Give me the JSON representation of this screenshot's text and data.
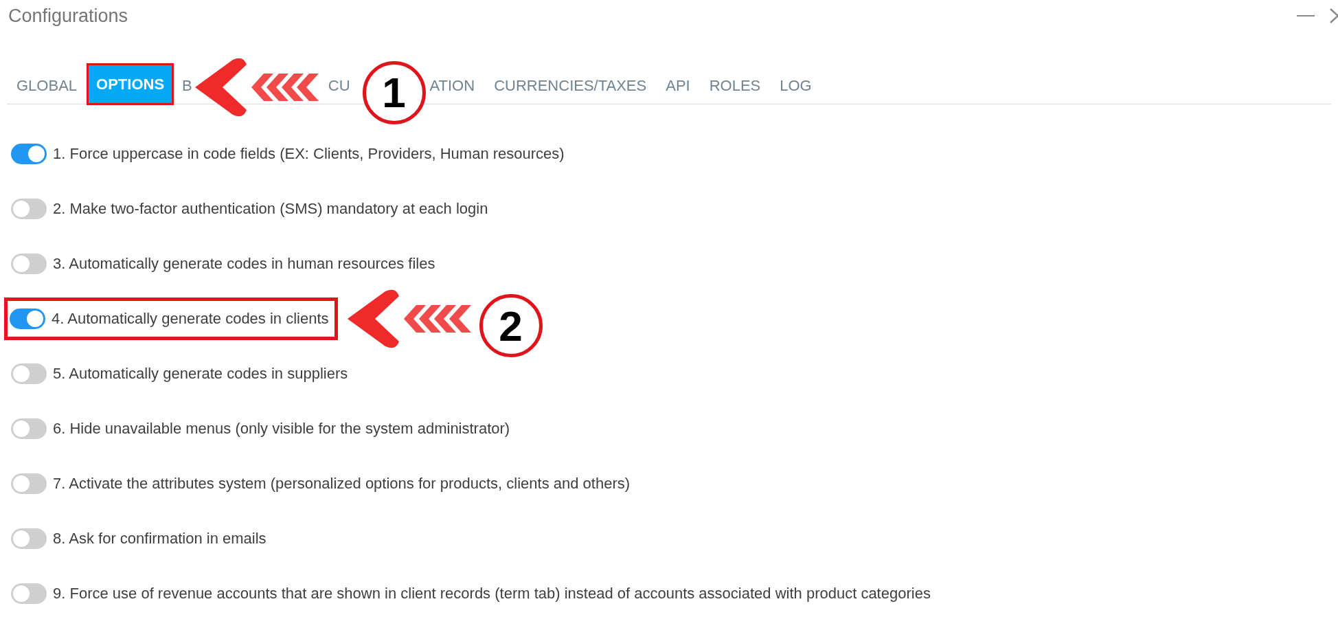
{
  "window": {
    "title": "Configurations"
  },
  "tabs": [
    {
      "label": "GLOBAL",
      "selected": false
    },
    {
      "label": "OPTIONS",
      "selected": true
    },
    {
      "label": "B",
      "selected": false
    },
    {
      "label": "CU",
      "label_end": "ATION",
      "selected": false
    },
    {
      "label": "CURRENCIES/TAXES",
      "selected": false
    },
    {
      "label": "API",
      "selected": false
    },
    {
      "label": "ROLES",
      "selected": false
    },
    {
      "label": "LOG",
      "selected": false
    }
  ],
  "options": [
    {
      "label": "1. Force uppercase in code fields (EX: Clients, Providers, Human resources)",
      "on": true,
      "highlighted": false
    },
    {
      "label": "2. Make two-factor authentication (SMS) mandatory at each login",
      "on": false,
      "highlighted": false
    },
    {
      "label": "3. Automatically generate codes in human resources files",
      "on": false,
      "highlighted": false
    },
    {
      "label": "4. Automatically generate codes in clients",
      "on": true,
      "highlighted": true
    },
    {
      "label": "5. Automatically generate codes in suppliers",
      "on": false,
      "highlighted": false
    },
    {
      "label": "6. Hide unavailable menus (only visible for the system administrator)",
      "on": false,
      "highlighted": false
    },
    {
      "label": "7. Activate the attributes system (personalized options for products, clients and others)",
      "on": false,
      "highlighted": false
    },
    {
      "label": "8. Ask for confirmation in emails",
      "on": false,
      "highlighted": false
    },
    {
      "label": "9. Force use of revenue accounts that are shown in client records (term tab) instead of accounts associated with product categories",
      "on": false,
      "highlighted": false
    }
  ],
  "callouts": [
    {
      "number": "1"
    },
    {
      "number": "2"
    }
  ]
}
